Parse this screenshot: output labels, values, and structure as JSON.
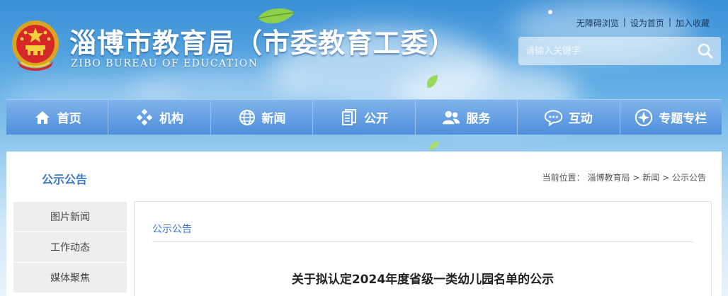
{
  "header": {
    "title": "淄博市教育局（市委教育工委）",
    "subtitle": "ZIBO BUREAU OF EDUCATION",
    "top_links": [
      "无障碍浏览",
      "设为首页",
      "加入收藏"
    ],
    "search_placeholder": "请输入关键字"
  },
  "nav": {
    "items": [
      {
        "label": "首页",
        "icon": "home-icon"
      },
      {
        "label": "机构",
        "icon": "org-icon"
      },
      {
        "label": "新闻",
        "icon": "globe-icon"
      },
      {
        "label": "公开",
        "icon": "documents-icon"
      },
      {
        "label": "服务",
        "icon": "users-icon"
      },
      {
        "label": "互动",
        "icon": "chat-icon"
      },
      {
        "label": "专题专栏",
        "icon": "compass-icon"
      }
    ]
  },
  "content": {
    "section_title": "公示公告",
    "breadcrumb": {
      "prefix": "当前位置：",
      "items": [
        "淄博教育局",
        "新闻",
        "公示公告"
      ],
      "sep": ">"
    },
    "sidebar": [
      "图片新闻",
      "工作动态",
      "媒体聚焦"
    ],
    "article": {
      "category": "公示公告",
      "title": "关于拟认定2024年度省级一类幼儿园名单的公示"
    }
  },
  "colors": {
    "nav_bg": "#4f8fdd",
    "accent": "#3a78c6"
  }
}
